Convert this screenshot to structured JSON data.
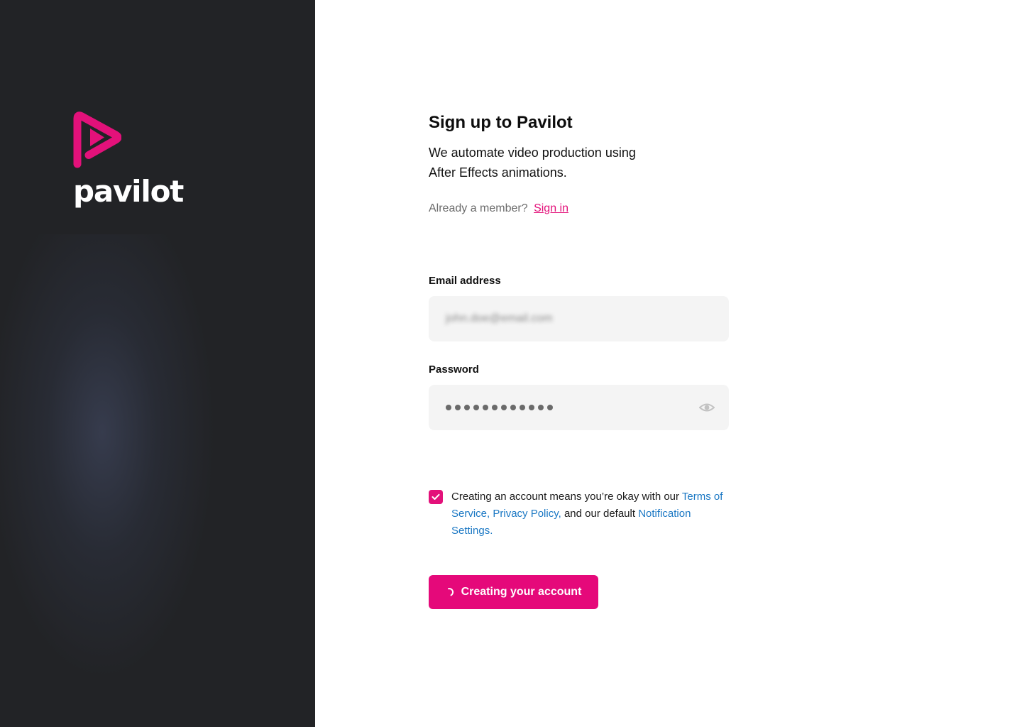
{
  "brand": {
    "name": "pavilot",
    "accent_color": "#e3117a",
    "logo_icon": "play-triangle-logo-icon"
  },
  "signup": {
    "title": "Sign up to Pavilot",
    "subtitle": "We automate video production using After Effects animations.",
    "member_prompt": "Already a member?",
    "signin_link": "Sign in",
    "email_label": "Email address",
    "email_value": "john.doe@email.com",
    "password_label": "Password",
    "password_masked_length": 12,
    "show_password_icon": "eye-icon",
    "terms_checked": true,
    "terms_text_before": "Creating an account means you’re okay with our ",
    "terms_link": "Terms of Service,",
    "privacy_link": "Privacy Policy,",
    "terms_text_middle": " and our default ",
    "notification_link": "Notification Settings.",
    "submit_label": "Creating your account",
    "submit_state": "loading"
  }
}
